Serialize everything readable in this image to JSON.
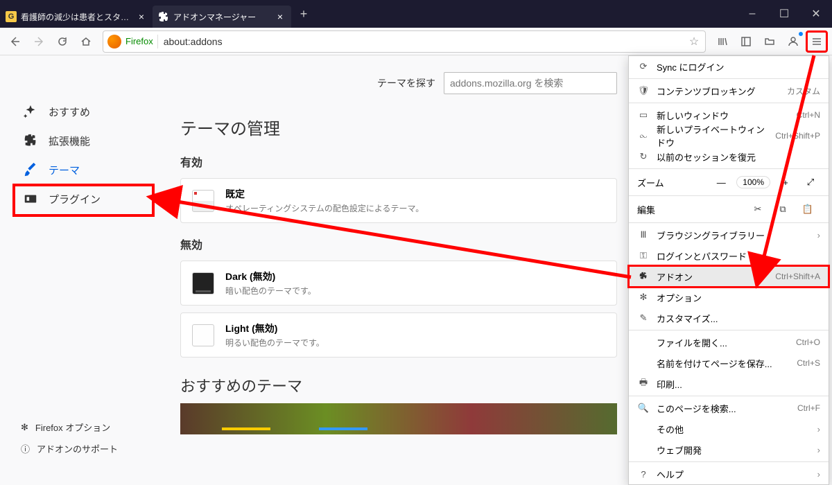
{
  "window": {
    "minimize": "–",
    "maximize": "☐",
    "close": "✕",
    "newtab": "+"
  },
  "tabs": [
    {
      "favicon": "G",
      "title": "看護師の減少は患者とスタッフの現"
    },
    {
      "favicon": "puzzle",
      "title": "アドオンマネージャー"
    }
  ],
  "urlbar": {
    "brand": "Firefox",
    "url": "about:addons"
  },
  "sidebar": {
    "items": [
      {
        "label": "おすすめ"
      },
      {
        "label": "拡張機能"
      },
      {
        "label": "テーマ"
      },
      {
        "label": "プラグイン"
      }
    ],
    "footer": [
      {
        "label": "Firefox オプション"
      },
      {
        "label": "アドオンのサポート"
      }
    ]
  },
  "search": {
    "label": "テーマを探す",
    "placeholder": "addons.mozilla.org を検索"
  },
  "headings": {
    "manage": "テーマの管理",
    "enabled": "有効",
    "disabled": "無効",
    "recommended": "おすすめのテーマ"
  },
  "themes": {
    "default": {
      "title": "既定",
      "desc": "オペレーティングシステムの配色設定によるテーマ。"
    },
    "dark": {
      "title": "Dark (無効)",
      "desc": "暗い配色のテーマです。"
    },
    "light": {
      "title": "Light (無効)",
      "desc": "明るい配色のテーマです。"
    }
  },
  "menu": {
    "sync": "Sync にログイン",
    "contentblocking": {
      "label": "コンテンツブロッキング",
      "badge": "カスタム"
    },
    "newwin": {
      "label": "新しいウィンドウ",
      "short": "Ctrl+N"
    },
    "newpriv": {
      "label": "新しいプライベートウィンドウ",
      "short": "Ctrl+Shift+P"
    },
    "restore": "以前のセッションを復元",
    "zoom": {
      "label": "ズーム",
      "minus": "—",
      "value": "100%",
      "plus": "+"
    },
    "edit": "編集",
    "library": "ブラウジングライブラリー",
    "logins": "ログインとパスワード",
    "addons": {
      "label": "アドオン",
      "short": "Ctrl+Shift+A"
    },
    "options": "オプション",
    "customize": "カスタマイズ...",
    "openfile": {
      "label": "ファイルを開く...",
      "short": "Ctrl+O"
    },
    "saveas": {
      "label": "名前を付けてページを保存...",
      "short": "Ctrl+S"
    },
    "print": "印刷...",
    "findpage": {
      "label": "このページを検索...",
      "short": "Ctrl+F"
    },
    "more": "その他",
    "webdev": "ウェブ開発",
    "help": "ヘルプ"
  }
}
